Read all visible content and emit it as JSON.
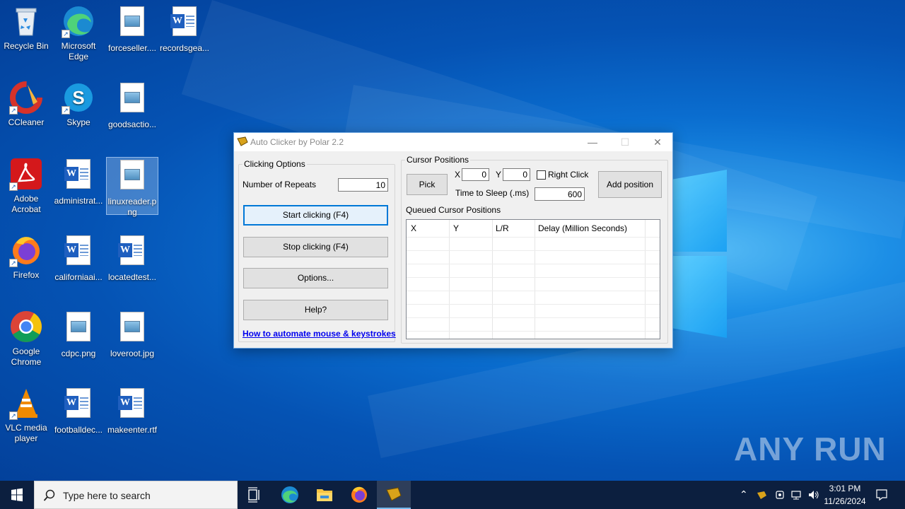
{
  "desktop": {
    "icons": [
      {
        "label": "Recycle Bin"
      },
      {
        "label": "Microsoft Edge"
      },
      {
        "label": "forceseller...."
      },
      {
        "label": "recordsgea..."
      },
      {
        "label": "CCleaner"
      },
      {
        "label": "Skype"
      },
      {
        "label": "goodsactio..."
      },
      {
        "label": "Adobe Acrobat"
      },
      {
        "label": "administrat..."
      },
      {
        "label": "linuxreader.png"
      },
      {
        "label": "Firefox"
      },
      {
        "label": "californiaai..."
      },
      {
        "label": "locatedtest..."
      },
      {
        "label": "Google Chrome"
      },
      {
        "label": "cdpc.png"
      },
      {
        "label": "loveroot.jpg"
      },
      {
        "label": "VLC media player"
      },
      {
        "label": "footballdec..."
      },
      {
        "label": "makeenter.rtf"
      }
    ],
    "watermark": "ANY RUN"
  },
  "window": {
    "title": "Auto Clicker by Polar 2.2",
    "clicking_options": {
      "group_label": "Clicking Options",
      "repeats_label": "Number of Repeats",
      "repeats_value": "10",
      "start_label": "Start clicking (F4)",
      "stop_label": "Stop clicking (F4)",
      "options_label": "Options...",
      "help_label": "Help?",
      "link_label": "How to automate mouse & keystrokes"
    },
    "cursor_positions": {
      "group_label": "Cursor Positions",
      "pick_label": "Pick",
      "x_label": "X",
      "x_value": "0",
      "y_label": "Y",
      "y_value": "0",
      "right_click_label": "Right Click",
      "right_click_checked": false,
      "sleep_label": "Time to Sleep (.ms)",
      "sleep_value": "600",
      "add_label": "Add position",
      "queue_label": "Queued Cursor Positions",
      "columns": [
        "X",
        "Y",
        "L/R",
        "Delay (Million Seconds)"
      ]
    }
  },
  "taskbar": {
    "search_placeholder": "Type here to search",
    "time": "3:01 PM",
    "date": "11/26/2024"
  }
}
